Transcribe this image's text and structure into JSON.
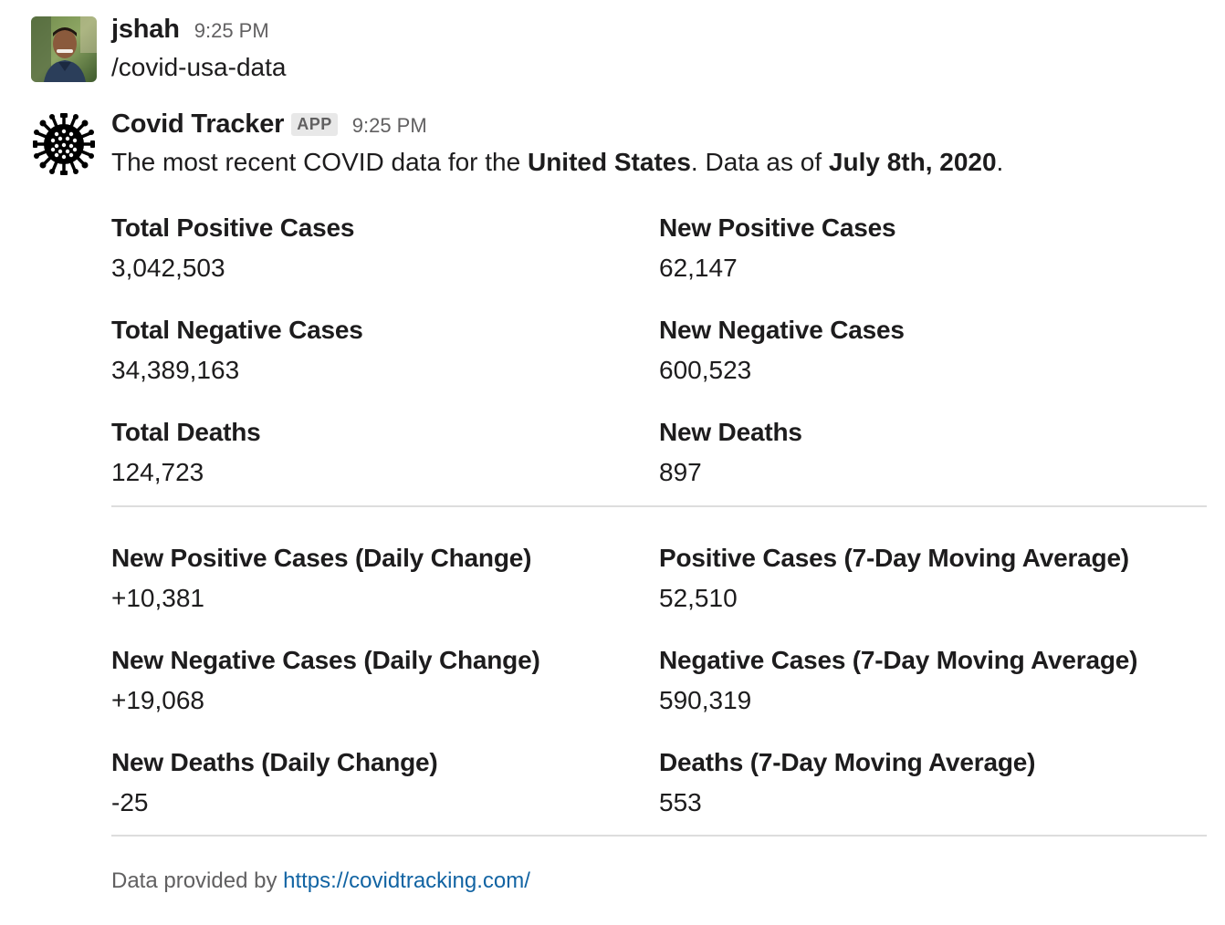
{
  "messages": [
    {
      "sender": "jshah",
      "time": "9:25 PM",
      "text": "/covid-usa-data"
    },
    {
      "sender": "Covid Tracker",
      "badge": "APP",
      "time": "9:25 PM",
      "intro": {
        "prefix": "The most recent COVID data for the ",
        "country": "United States",
        "middle": ". Data as of ",
        "date": "July 8th, 2020",
        "suffix": "."
      }
    }
  ],
  "fields_section_1": [
    {
      "label": "Total Positive Cases",
      "value": "3,042,503"
    },
    {
      "label": "New Positive Cases",
      "value": "62,147"
    },
    {
      "label": "Total Negative Cases",
      "value": "34,389,163"
    },
    {
      "label": "New Negative Cases",
      "value": "600,523"
    },
    {
      "label": "Total Deaths",
      "value": "124,723"
    },
    {
      "label": "New Deaths",
      "value": "897"
    }
  ],
  "fields_section_2": [
    {
      "label": "New Positive Cases (Daily Change)",
      "value": "+10,381"
    },
    {
      "label": "Positive Cases (7-Day Moving Average)",
      "value": "52,510"
    },
    {
      "label": "New Negative Cases (Daily Change)",
      "value": "+19,068"
    },
    {
      "label": "Negative Cases (7-Day Moving Average)",
      "value": "590,319"
    },
    {
      "label": "New Deaths (Daily Change)",
      "value": "-25"
    },
    {
      "label": "Deaths (7-Day Moving Average)",
      "value": "553"
    }
  ],
  "footer": {
    "prefix": "Data provided by ",
    "link_text": "https://covidtracking.com/"
  },
  "colors": {
    "text": "#1d1c1d",
    "muted": "#616061",
    "link": "#1264a3",
    "divider": "#dddddd",
    "badge_bg": "#e8e8e8"
  },
  "icons": {
    "user_avatar": "user-photo-avatar",
    "bot_avatar": "virus-icon"
  }
}
